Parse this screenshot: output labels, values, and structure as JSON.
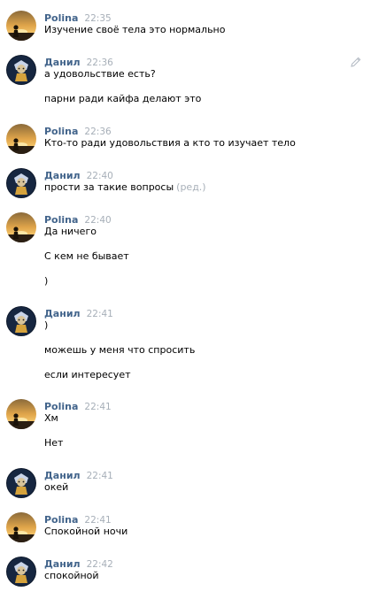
{
  "icons": {
    "edit": "pencil-icon",
    "polina_avatar": "sunset-avatar",
    "danil_avatar": "character-avatar"
  },
  "colors": {
    "author": "#42648b",
    "time": "#a7afb8",
    "text": "#000000"
  },
  "messages": [
    {
      "author": "Polina",
      "time": "22:35",
      "lines": [
        "Изучение своё тела это нормально"
      ]
    },
    {
      "author": "Данил",
      "time": "22:36",
      "lines": [
        "а удовольствие есть?",
        "парни ради кайфа делают это"
      ]
    },
    {
      "author": "Polina",
      "time": "22:36",
      "lines": [
        "Кто-то ради удовольствия а кто то изучает тело"
      ]
    },
    {
      "author": "Данил",
      "time": "22:40",
      "lines": [
        "прости за такие вопросы"
      ],
      "edited": "(ред.)"
    },
    {
      "author": "Polina",
      "time": "22:40",
      "lines": [
        "Да ничего",
        "С кем не бывает",
        ")"
      ]
    },
    {
      "author": "Данил",
      "time": "22:41",
      "lines": [
        ")",
        "можешь у меня что спросить",
        "если интересует"
      ]
    },
    {
      "author": "Polina",
      "time": "22:41",
      "lines": [
        "Хм",
        "Нет"
      ]
    },
    {
      "author": "Данил",
      "time": "22:41",
      "lines": [
        "окей"
      ]
    },
    {
      "author": "Polina",
      "time": "22:41",
      "lines": [
        "Спокойной ночи"
      ]
    },
    {
      "author": "Данил",
      "time": "22:42",
      "lines": [
        "спокойной"
      ]
    }
  ]
}
